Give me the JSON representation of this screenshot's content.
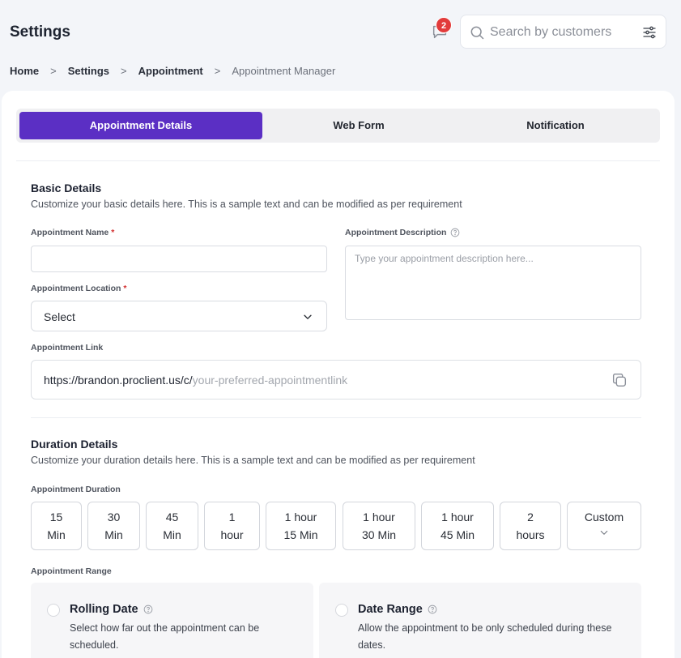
{
  "header": {
    "title": "Settings",
    "notification_count": "2",
    "search": {
      "placeholder": "Search by customers",
      "value": ""
    }
  },
  "breadcrumb": [
    "Home",
    "Settings",
    "Appointment",
    "Appointment Manager"
  ],
  "breadcrumb_separator": ">",
  "tabs": [
    {
      "label": "Appointment Details",
      "active": true
    },
    {
      "label": "Web Form",
      "active": false
    },
    {
      "label": "Notification",
      "active": false
    }
  ],
  "basic_details": {
    "title": "Basic Details",
    "subtitle": "Customize your basic details here. This is a sample text and can be modified as per requirement",
    "name_label": "Appointment Name",
    "name_value": "",
    "description_label": "Appointment Description",
    "description_placeholder": "Type your appointment description here...",
    "location_label": "Appointment Location",
    "location_value": "Select",
    "required_marker": "*",
    "link_label": "Appointment Link",
    "link_prefix": "https://brandon.proclient.us/c/",
    "link_placeholder": "your-preferred-appointmentlink"
  },
  "duration_details": {
    "title": "Duration Details",
    "subtitle": "Customize your duration details here. This is a sample text and can be modified as per requirement",
    "duration_label": "Appointment Duration",
    "options": [
      {
        "line1": "15",
        "line2": "Min"
      },
      {
        "line1": "30",
        "line2": "Min"
      },
      {
        "line1": "45",
        "line2": "Min"
      },
      {
        "line1": "1",
        "line2": "hour"
      },
      {
        "line1": "1 hour",
        "line2": "15 Min"
      },
      {
        "line1": "1 hour",
        "line2": "30 Min"
      },
      {
        "line1": "1 hour",
        "line2": "45 Min"
      },
      {
        "line1": "2",
        "line2": "hours"
      },
      {
        "line1": "Custom",
        "line2": ""
      }
    ],
    "range_label": "Appointment Range",
    "ranges": [
      {
        "title": "Rolling Date",
        "description": "Select how far out the appointment can be scheduled."
      },
      {
        "title": "Date Range",
        "description": "Allow the appointment to be only scheduled during these dates."
      }
    ]
  },
  "colors": {
    "accent": "#5b2fc4",
    "badge": "#e23b3b",
    "background": "#f3f5f9"
  }
}
